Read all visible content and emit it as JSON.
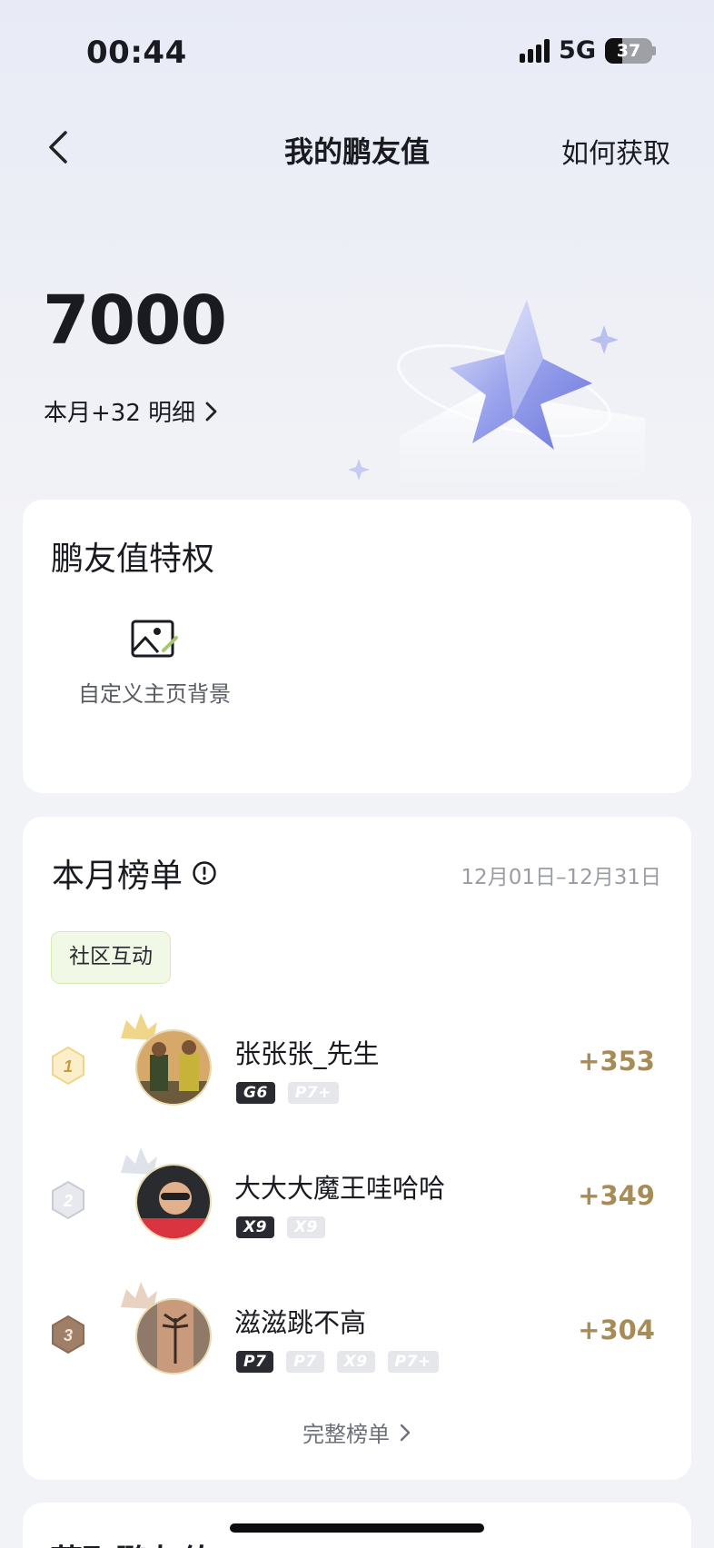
{
  "status": {
    "time": "00:44",
    "network": "5G",
    "battery": "37",
    "battery_level": 0.37
  },
  "nav": {
    "title": "我的鹏友值",
    "action": "如何获取"
  },
  "summary": {
    "points": "7000",
    "monthly": "本月+32 明细"
  },
  "privileges": {
    "title": "鹏友值特权",
    "items": [
      {
        "label": "自定义主页背景",
        "icon": "image-edit-icon"
      }
    ]
  },
  "ranking": {
    "title": "本月榜单",
    "date_range": "12月01日–12月31日",
    "tag": "社区互动",
    "rows": [
      {
        "rank": "1",
        "name": "张张张_先生",
        "score": "+353",
        "badges": [
          {
            "label": "G6",
            "style": "dark"
          },
          {
            "label": "P7+",
            "style": "light"
          }
        ]
      },
      {
        "rank": "2",
        "name": "大大大魔王哇哈哈",
        "score": "+349",
        "badges": [
          {
            "label": "X9",
            "style": "dark"
          },
          {
            "label": "X9",
            "style": "light"
          }
        ]
      },
      {
        "rank": "3",
        "name": "滋滋跳不高",
        "score": "+304",
        "badges": [
          {
            "label": "P7",
            "style": "dark"
          },
          {
            "label": "P7",
            "style": "light"
          },
          {
            "label": "X9",
            "style": "light"
          },
          {
            "label": "P7+",
            "style": "light"
          }
        ]
      }
    ],
    "full_link": "完整榜单"
  },
  "next_section": {
    "title": "获取鹏友值"
  },
  "colors": {
    "score": "#a88c58",
    "gold": "#f0d68a",
    "silver": "#c9ccd4",
    "bronze": "#a07f68"
  }
}
